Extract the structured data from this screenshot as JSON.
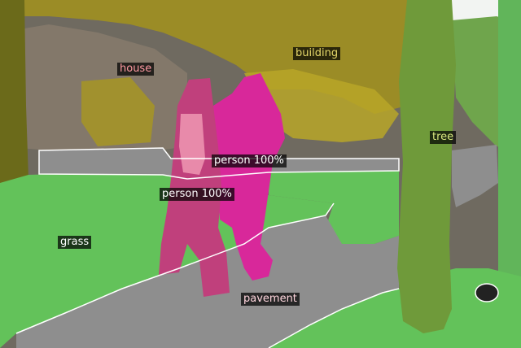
{
  "segments": [
    {
      "id": "building",
      "label": "building",
      "color": "#c8b800"
    },
    {
      "id": "house",
      "label": "house",
      "color": "#ff9aa2"
    },
    {
      "id": "tree",
      "label": "tree",
      "color": "#d9e880"
    },
    {
      "id": "person-1",
      "label": "person 100%",
      "color": "#ffffff"
    },
    {
      "id": "person-2",
      "label": "person 100%",
      "color": "#ffffff"
    },
    {
      "id": "grass",
      "label": "grass",
      "color": "#ffffff"
    },
    {
      "id": "pavement",
      "label": "pavement",
      "color": "#ffd6de"
    }
  ],
  "colors": {
    "sky": "#f2f4f2",
    "building_mask": "#a09020",
    "house_mask": "#6f6a60",
    "tree_mask": "#6f9a3a",
    "grass_mask": "#63c25a",
    "pavement_mask": "#8e8e8e",
    "person_front_mask": "#c0407c",
    "person_back_mask": "#d8289a",
    "outline": "#ffffff"
  }
}
